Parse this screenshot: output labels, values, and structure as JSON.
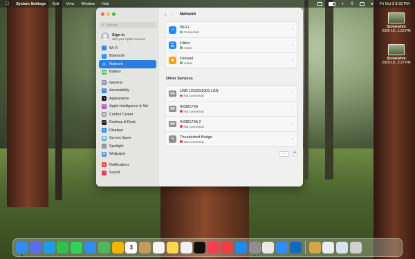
{
  "menubar": {
    "app_name": "System Settings",
    "menus": [
      "Edit",
      "View",
      "Window",
      "Help"
    ],
    "datetime": "Fri Oct 3  8:33 PM"
  },
  "desktop": {
    "files": [
      {
        "name": "Screenshot",
        "sub": "2025-10...1.53 PM"
      },
      {
        "name": "Screenshot",
        "sub": "2025-10...2.27 PM"
      }
    ]
  },
  "sidebar": {
    "search_placeholder": "Search",
    "signin_title": "Sign in",
    "signin_sub": "with your Apple Account",
    "groups": [
      [
        {
          "label": "Wi-Fi",
          "icon": "wifi-icon",
          "color": "#1e8bf0"
        },
        {
          "label": "Bluetooth",
          "icon": "bluetooth-icon",
          "color": "#1e8bf0"
        },
        {
          "label": "Network",
          "icon": "globe-icon",
          "color": "#1e8bf0",
          "selected": true
        },
        {
          "label": "Battery",
          "icon": "battery-icon",
          "color": "#35c759"
        }
      ],
      [
        {
          "label": "General",
          "icon": "gear-icon",
          "color": "#8e8e93"
        },
        {
          "label": "Accessibility",
          "icon": "accessibility-icon",
          "color": "#1e8bf0"
        },
        {
          "label": "Appearance",
          "icon": "appearance-icon",
          "color": "#1c1c1e"
        },
        {
          "label": "Apple Intelligence & Siri",
          "icon": "siri-icon",
          "color": "#c04ad6"
        },
        {
          "label": "Control Center",
          "icon": "control-center-icon",
          "color": "#8e8e93"
        },
        {
          "label": "Desktop & Dock",
          "icon": "dock-icon",
          "color": "#1c1c1e"
        },
        {
          "label": "Displays",
          "icon": "display-icon",
          "color": "#1e8bf0"
        },
        {
          "label": "Screen Saver",
          "icon": "screensaver-icon",
          "color": "#3fb8d8"
        },
        {
          "label": "Spotlight",
          "icon": "spotlight-icon",
          "color": "#8e8e93"
        },
        {
          "label": "Wallpaper",
          "icon": "wallpaper-icon",
          "color": "#3a9ae8"
        }
      ],
      [
        {
          "label": "Notifications",
          "icon": "bell-icon",
          "color": "#ff3b30"
        },
        {
          "label": "Sound",
          "icon": "speaker-icon",
          "color": "#ff2d55"
        }
      ]
    ]
  },
  "main": {
    "title": "Network",
    "primary_services": [
      {
        "name": "Wi-Fi",
        "status": "Connected",
        "status_color": "#34c759",
        "icon": "wifi-icon",
        "color": "#1e8bf0"
      },
      {
        "name": "Filters",
        "status": "Active",
        "status_color": "#34c759",
        "icon": "filter-icon",
        "color": "#1e8bf0"
      },
      {
        "name": "Firewall",
        "status": "Active",
        "status_color": "#34c759",
        "icon": "firewall-icon",
        "color": "#ff9f0a"
      }
    ],
    "other_title": "Other Services",
    "other_services": [
      {
        "name": "USB 10/100/1000 LAN",
        "status": "Not connected",
        "status_color": "#ff3b30",
        "icon": "ethernet-icon"
      },
      {
        "name": "AX88179A",
        "status": "Not connected",
        "status_color": "#ff3b30",
        "icon": "ethernet-icon"
      },
      {
        "name": "AX88179A 2",
        "status": "Not connected",
        "status_color": "#ff3b30",
        "icon": "ethernet-icon"
      },
      {
        "name": "Thunderbolt Bridge",
        "status": "Not connected",
        "status_color": "#ff3b30",
        "icon": "thunderbolt-icon"
      }
    ],
    "more_label": "···",
    "help_label": "?"
  },
  "dock": {
    "apps": [
      {
        "name": "Finder",
        "icon": "finder-icon",
        "color": "#2c8ef8",
        "running": true
      },
      {
        "name": "Launchpad",
        "icon": "launchpad-icon",
        "color": "#5a6cf0"
      },
      {
        "name": "Safari",
        "icon": "safari-icon",
        "color": "#1a9cf0"
      },
      {
        "name": "FaceTime",
        "icon": "facetime-icon",
        "color": "#2fc14e"
      },
      {
        "name": "Messages",
        "icon": "messages-icon",
        "color": "#30d158"
      },
      {
        "name": "Mail",
        "icon": "mail-icon",
        "color": "#2e8ff0"
      },
      {
        "name": "Maps",
        "icon": "maps-icon",
        "color": "#4fb85a"
      },
      {
        "name": "Photos",
        "icon": "photos-icon",
        "color": "#f4b400"
      },
      {
        "name": "Calendar",
        "icon": "calendar-icon",
        "color": "#ffffff",
        "label": "3"
      },
      {
        "name": "Contacts",
        "icon": "contacts-icon",
        "color": "#c89a5a"
      },
      {
        "name": "Reminders",
        "icon": "reminders-icon",
        "color": "#f5f5f5"
      },
      {
        "name": "Notes",
        "icon": "notes-icon",
        "color": "#ffd84a"
      },
      {
        "name": "Freeform",
        "icon": "freeform-icon",
        "color": "#f0f0f0"
      },
      {
        "name": "TV",
        "icon": "tv-icon",
        "color": "#111111"
      },
      {
        "name": "Music",
        "icon": "music-icon",
        "color": "#fa3c50"
      },
      {
        "name": "News",
        "icon": "news-icon",
        "color": "#f23d44"
      },
      {
        "name": "App Store",
        "icon": "appstore-icon",
        "color": "#1b8cf2"
      },
      {
        "name": "System Settings",
        "icon": "settings-icon",
        "color": "#8e8e93",
        "running": true
      },
      {
        "name": "Preview",
        "icon": "preview-icon",
        "color": "#e8e8e8"
      },
      {
        "name": "Zoom",
        "icon": "zoom-icon",
        "color": "#2d8cff"
      },
      {
        "name": "Outlook",
        "icon": "outlook-icon",
        "color": "#0f6cbd"
      }
    ],
    "right": [
      {
        "name": "Downloads",
        "icon": "downloads-icon",
        "color": "#d9a441"
      },
      {
        "name": "Screenshot stack",
        "icon": "stack-icon",
        "color": "#e8eef5"
      },
      {
        "name": "Documents",
        "icon": "documents-icon",
        "color": "#d7e3f1"
      },
      {
        "name": "Trash",
        "icon": "trash-icon",
        "color": "#d0d0d0"
      }
    ]
  }
}
